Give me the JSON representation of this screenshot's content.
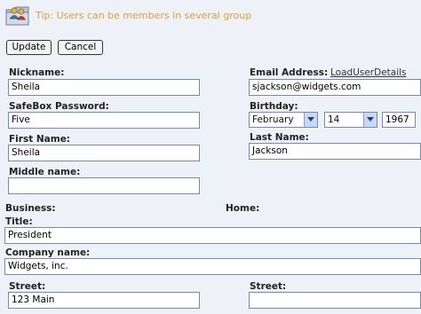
{
  "tip": {
    "text": "Tip: Users can be members in several group",
    "icon": "folder-group-icon"
  },
  "buttons": {
    "update": "Update",
    "cancel": "Cancel"
  },
  "form": {
    "nickname": {
      "label": "Nickname:",
      "value": "Sheila"
    },
    "password": {
      "label": "SafeBox Password:",
      "value": "Five"
    },
    "first_name": {
      "label": "First Name:",
      "value": "Sheila"
    },
    "middle_name": {
      "label": "Middle name:",
      "value": ""
    },
    "email": {
      "label": "Email Address:",
      "link": "LoadUserDetails",
      "value": "sjackson@widgets.com"
    },
    "birthday": {
      "label": "Birthday:",
      "month": "February",
      "day": "14",
      "year": "1967"
    },
    "last_name": {
      "label": "Last Name:",
      "value": "Jackson"
    }
  },
  "sections": {
    "business": "Business:",
    "home": "Home:"
  },
  "business": {
    "title": {
      "label": "Title:",
      "value": "President"
    },
    "company": {
      "label": "Company name:",
      "value": "Widgets, inc."
    },
    "street": {
      "label": "Street:",
      "value": "123 Main"
    }
  },
  "home": {
    "street": {
      "label": "Street:",
      "value": ""
    }
  }
}
